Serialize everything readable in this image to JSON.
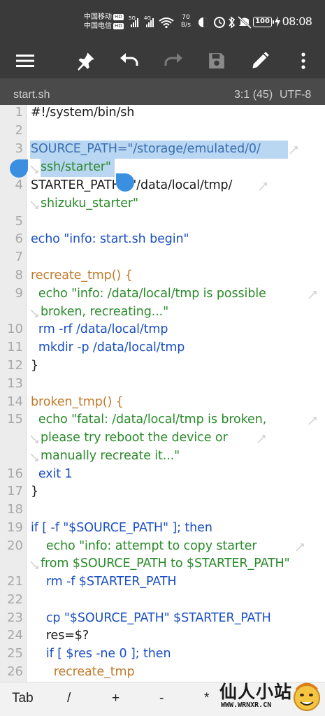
{
  "status_bar": {
    "carrier1": "中国移动",
    "carrier2": "中国电信",
    "hd": "HD",
    "net1": "5G",
    "net2": "4G",
    "speed_value": "70",
    "speed_unit": "B/s",
    "battery": "100",
    "time": "08:08"
  },
  "toolbar": {
    "menu": "menu-icon",
    "pin": "pin-icon",
    "undo": "undo-icon",
    "redo": "redo-icon",
    "save": "save-icon",
    "edit": "pencil-icon",
    "more": "more-vert-icon"
  },
  "file_info": {
    "filename": "start.sh",
    "position": "3:1 (45)",
    "encoding": "UTF-8"
  },
  "editor": {
    "line_numbers": [
      "1",
      "2",
      "3",
      "4",
      "5",
      "6",
      "7",
      "8",
      "9",
      "10",
      "11",
      "12",
      "13",
      "14",
      "15",
      "16",
      "17",
      "18",
      "19",
      "20",
      "21",
      "22",
      "23",
      "24",
      "25",
      "26"
    ],
    "lines": [
      "#!/system/bin/sh",
      "",
      "SOURCE_PATH=\"/storage/emulated/0/",
      "ssh/starter\"",
      "STARTER_PATH=\"/data/local/tmp/",
      "shizuku_starter\"",
      "",
      "echo \"info: start.sh begin\"",
      "",
      "recreate_tmp() {",
      "  echo \"info: /data/local/tmp is possible",
      "broken, recreating...\"",
      "  rm -rf /data/local/tmp",
      "  mkdir -p /data/local/tmp",
      "}",
      "",
      "broken_tmp() {",
      "  echo \"fatal: /data/local/tmp is broken,",
      "please try reboot the device or",
      "manually recreate it...\"",
      "  exit 1",
      "}",
      "",
      "if [ -f \"$SOURCE_PATH\" ]; then",
      "    echo \"info: attempt to copy starter",
      "from $SOURCE_PATH to $STARTER_PATH\"",
      "    rm -f $STARTER_PATH",
      "",
      "    cp \"$SOURCE_PATH\" $STARTER_PATH",
      "    res=$?",
      "    if [ $res -ne 0 ]; then",
      "      recreate_tmp"
    ]
  },
  "keys": [
    "Tab",
    "/",
    "+",
    "-",
    "*"
  ],
  "watermark": {
    "title": "仙人小站",
    "url": "WWW.WRNXR.CN"
  }
}
